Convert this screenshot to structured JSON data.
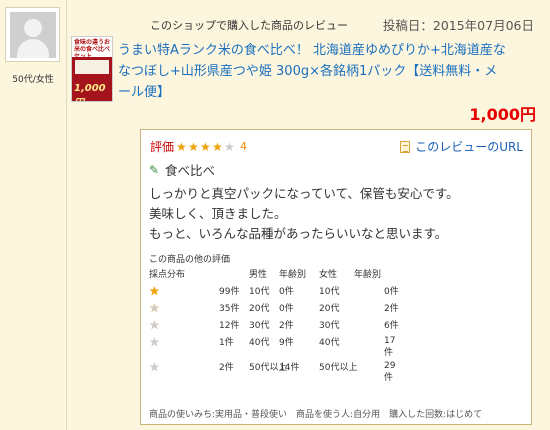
{
  "user": {
    "meta": "50代/女性"
  },
  "product": {
    "thumb_caption": "食味の違うお米の食べ比べセット",
    "thumb_price": "1,000円",
    "title_line1": "うまい特Aランク米の食べ比べ！ 北海道産ゆめぴりか+北海道産な",
    "title_line2": "なつぼし+山形県産つや姫 300g×各銘柄1パック【送料無料・メ",
    "title_line3": "ール便】",
    "price": "1,000円"
  },
  "header": {
    "shop_review_label": "このショップで購入した商品のレビュー",
    "posted": "投稿日：2015年07月06日"
  },
  "review": {
    "rating_label": "評価",
    "rating_value": 4,
    "rating_text": "4",
    "url_label": "このレビューのURL",
    "subject": "食べ比べ",
    "body_line1": "しっかりと真空パックになっていて、保管も安心です。",
    "body_line2": "美味しく、頂きました。",
    "body_line3": "もっと、いろんな品種があったらいいなと思います。"
  },
  "distribution": {
    "section_title": "この商品の他の評価",
    "headers": [
      "採点分布",
      "",
      "男性",
      "年齢別",
      "女性",
      "年齢別"
    ],
    "rows": [
      {
        "stars": 5,
        "count": "99件",
        "m_age": "10代",
        "m_count": "0件",
        "f_age": "10代",
        "f_count": "0件"
      },
      {
        "stars": 4,
        "count": "35件",
        "m_age": "20代",
        "m_count": "0件",
        "f_age": "20代",
        "f_count": "2件"
      },
      {
        "stars": 3,
        "count": "12件",
        "m_age": "30代",
        "m_count": "2件",
        "f_age": "30代",
        "f_count": "6件"
      },
      {
        "stars": 2,
        "count": "1件",
        "m_age": "40代",
        "m_count": "9件",
        "f_age": "40代",
        "f_count": "17件"
      },
      {
        "stars": 1,
        "count": "2件",
        "m_age": "50代以上",
        "m_count": "14件",
        "f_age": "50代以上",
        "f_count": "29件"
      }
    ]
  },
  "footer": {
    "text": "商品の使いみち:実用品・普段使い　商品を使う人:自分用　購入した回数:はじめて"
  },
  "colors": {
    "link": "#1a6fbf",
    "price": "#e60000",
    "star": "#f1a008",
    "background": "#fdf6de"
  }
}
